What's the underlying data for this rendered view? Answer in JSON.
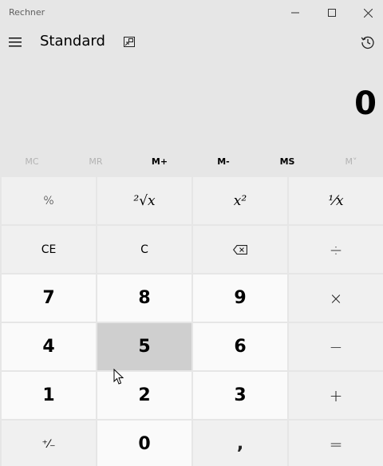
{
  "window": {
    "title": "Rechner"
  },
  "header": {
    "mode": "Standard"
  },
  "display": {
    "value": "0"
  },
  "memory": [
    {
      "label": "MC",
      "enabled": false
    },
    {
      "label": "MR",
      "enabled": false
    },
    {
      "label": "M+",
      "enabled": true
    },
    {
      "label": "M-",
      "enabled": true
    },
    {
      "label": "MS",
      "enabled": true
    },
    {
      "label": "M˅",
      "enabled": false
    }
  ],
  "keys": {
    "percent": "%",
    "root": "²√x",
    "square": "x²",
    "reciprocal": "⅟x",
    "clear_entry": "CE",
    "clear": "C",
    "divide": "÷",
    "seven": "7",
    "eight": "8",
    "nine": "9",
    "multiply": "×",
    "four": "4",
    "five": "5",
    "six": "6",
    "minus": "−",
    "one": "1",
    "two": "2",
    "three": "3",
    "plus": "+",
    "negate": "⁺⁄₋",
    "zero": "0",
    "decimal": ",",
    "equals": "="
  },
  "icons": {
    "minimize": "minimize-icon",
    "maximize": "maximize-icon",
    "close": "close-icon",
    "menu": "hamburger-icon",
    "keep_on_top": "keep-on-top-icon",
    "history": "history-icon",
    "backspace": "backspace-icon"
  },
  "colors": {
    "background": "#e6e6e6",
    "number_key": "#fafafa",
    "operator_key": "#f0f0f0",
    "pressed_key": "#cfcfcf",
    "disabled_text": "#b3b3b3"
  },
  "state": {
    "pressed_key": "5"
  }
}
